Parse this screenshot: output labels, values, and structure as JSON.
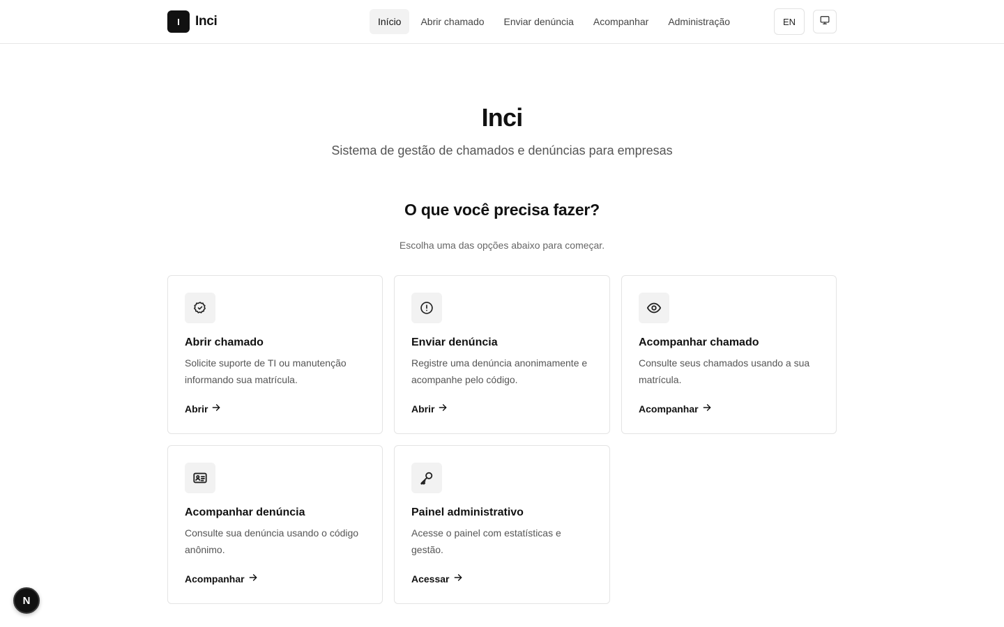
{
  "brand": {
    "mark": "I",
    "name": "Inci"
  },
  "nav": [
    {
      "label": "Início",
      "active": true
    },
    {
      "label": "Abrir chamado",
      "active": false
    },
    {
      "label": "Enviar denúncia",
      "active": false
    },
    {
      "label": "Acompanhar",
      "active": false
    },
    {
      "label": "Administração",
      "active": false
    }
  ],
  "header": {
    "lang_label": "EN",
    "theme_icon": "monitor-icon"
  },
  "hero": {
    "title": "Inci",
    "subtitle": "Sistema de gestão de chamados e denúncias para empresas"
  },
  "section": {
    "title": "O que você precisa fazer?",
    "subtitle": "Escolha uma das opções abaixo para começar."
  },
  "cards": [
    {
      "icon": "check-circle-icon",
      "title": "Abrir chamado",
      "description": "Solicite suporte de TI ou manutenção informando sua matrícula.",
      "action": "Abrir"
    },
    {
      "icon": "alert-circle-icon",
      "title": "Enviar denúncia",
      "description": "Registre uma denúncia anonimamente e acompanhe pelo código.",
      "action": "Abrir"
    },
    {
      "icon": "eye-icon",
      "title": "Acompanhar chamado",
      "description": "Consulte seus chamados usando a sua matrícula.",
      "action": "Acompanhar"
    },
    {
      "icon": "id-card-icon",
      "title": "Acompanhar denúncia",
      "description": "Consulte sua denúncia usando o código anônimo.",
      "action": "Acompanhar"
    },
    {
      "icon": "key-icon",
      "title": "Painel administrativo",
      "description": "Acesse o painel com estatísticas e gestão.",
      "action": "Acessar"
    }
  ],
  "badge": {
    "label": "N"
  },
  "colors": {
    "primary": "#111111",
    "muted_text": "#555555",
    "border": "#e4e4e4",
    "icon_bg": "#f2f2f2"
  }
}
